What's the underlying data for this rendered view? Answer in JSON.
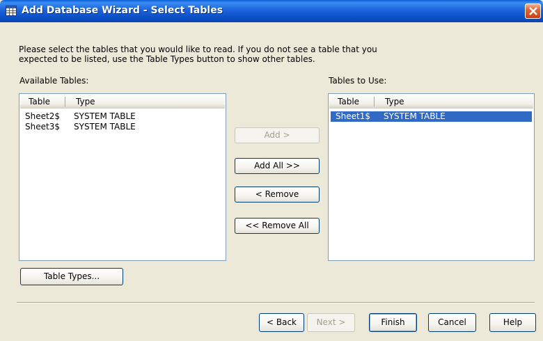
{
  "window": {
    "title": "Add Database Wizard - Select Tables",
    "title_bar_color": "#0a4fc4"
  },
  "instructions": {
    "line1": "Please select the tables that you would like to read.  If you do not see a table that you",
    "line2": "expected to be listed, use the Table Types button to show other tables."
  },
  "available": {
    "label": "Available Tables:",
    "columns": [
      "Table",
      "Type"
    ],
    "rows": [
      {
        "table": "Sheet2$",
        "type": "SYSTEM TABLE"
      },
      {
        "table": "Sheet3$",
        "type": "SYSTEM TABLE"
      }
    ]
  },
  "to_use": {
    "label": "Tables to Use:",
    "columns": [
      "Table",
      "Type"
    ],
    "rows": [
      {
        "table": "Sheet1$",
        "type": "SYSTEM TABLE",
        "selected": true
      }
    ],
    "selection_color": "#316ac5"
  },
  "transfer_buttons": {
    "add": "Add >",
    "add_all": "Add All >>",
    "remove": "< Remove",
    "remove_all": "<< Remove All"
  },
  "table_types_button": "Table Types...",
  "footer": {
    "back": "< Back",
    "next": "Next >",
    "finish": "Finish",
    "cancel": "Cancel",
    "help": "Help"
  },
  "icons": {
    "title_icon": "table-grid-icon",
    "close": "close-icon"
  }
}
